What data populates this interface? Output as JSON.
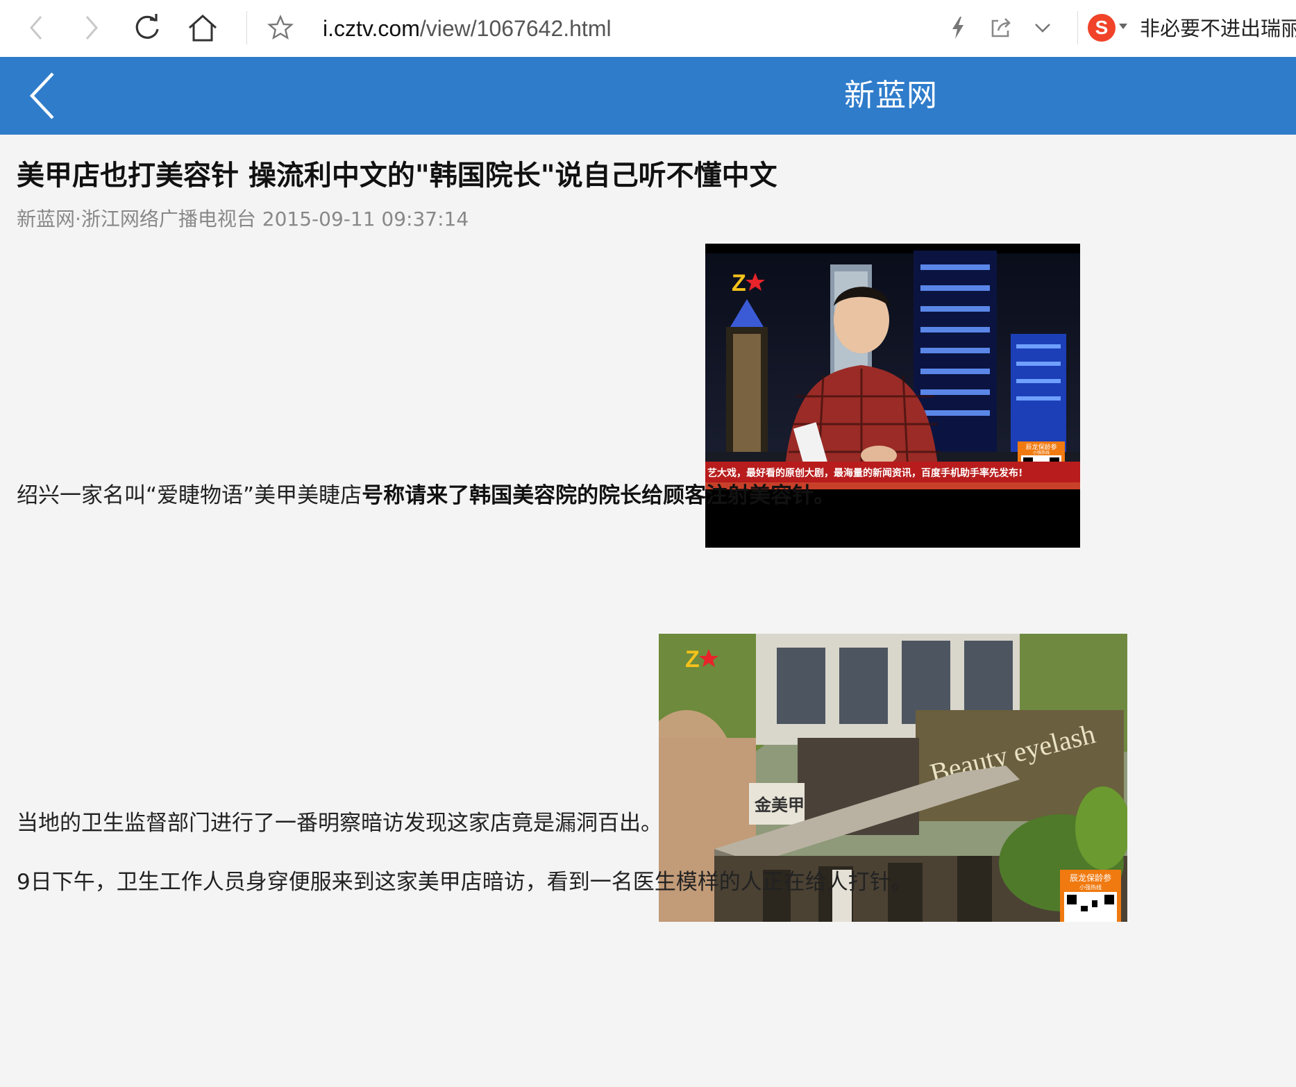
{
  "browser": {
    "url_host": "i.cztv.com",
    "url_path": "/view/1067642.html",
    "extension_text": "非必要不进出瑞丽",
    "sogou_label": "S"
  },
  "site": {
    "title": "新蓝网"
  },
  "article": {
    "headline": "美甲店也打美容针 操流利中文的\"韩国院长\"说自己听不懂中文",
    "meta": "新蓝网·浙江网络广播电视台 2015-09-11 09:37:14",
    "p1_plain": "绍兴一家名叫“爱睫物语”美甲美睫店",
    "p1_bold": "号称请来了韩国美容院的院长给顾客注射美容针。",
    "p2": "当地的卫生监督部门进行了一番明察暗访发现这家店竟是漏洞百出。",
    "p3": "9日下午，卫生工作人员身穿便服来到这家美甲店暗访，看到一名医生模样的人正在给人打针。",
    "image1": {
      "ticker": "艺大戏，最好看的原创大剧，最海量的新闻资讯，百度手机助手率先发布!",
      "badge": "辰龙保龄参",
      "badge_sub": "小强热线",
      "card": "小强热线"
    },
    "image2": {
      "sign": "Beauty eyelash",
      "badge": "辰龙保龄参",
      "badge_sub": "小强热线",
      "door_sign": "金美甲"
    }
  },
  "colors": {
    "header_blue": "#2f7ccb",
    "page_bg": "#f4f4f4",
    "sogou_red": "#f0432a",
    "badge_orange": "#f07a10"
  }
}
